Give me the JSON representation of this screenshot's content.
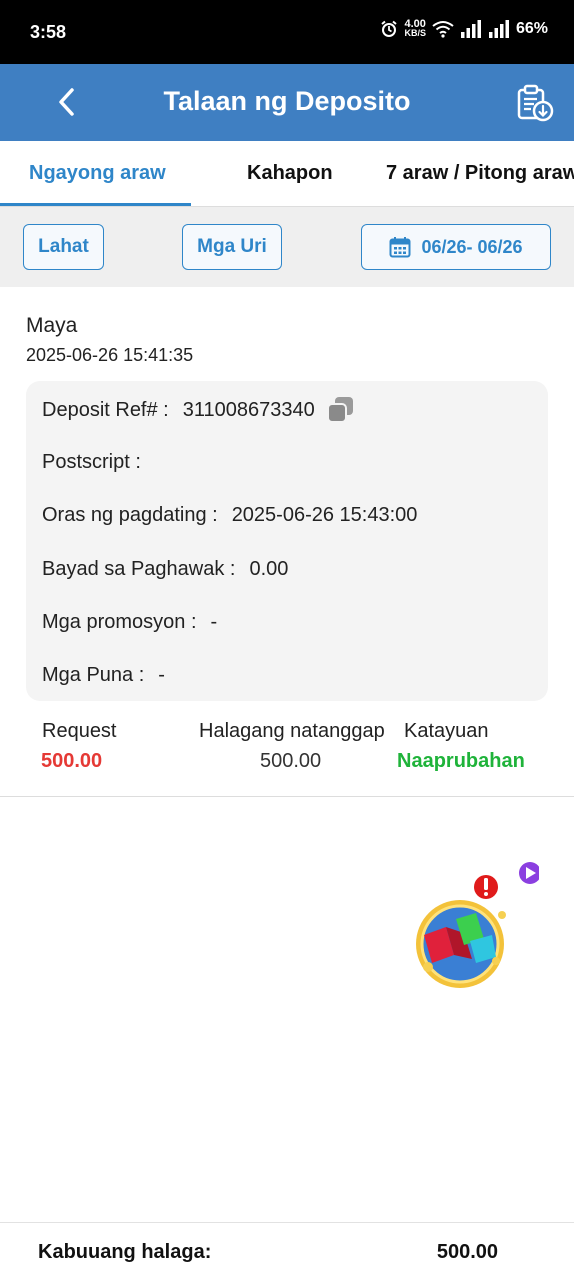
{
  "status_bar": {
    "time": "3:58",
    "net_speed_value": "4.00",
    "net_speed_unit": "KB/S",
    "battery": "66%"
  },
  "header": {
    "title": "Talaan ng Deposito",
    "back_icon": "chevron-left-icon",
    "report_icon": "clipboard-download-icon"
  },
  "tabs": [
    {
      "label": "Ngayong araw",
      "active": true
    },
    {
      "label": "Kahapon",
      "active": false
    },
    {
      "label": "7 araw / Pitong araw",
      "active": false
    }
  ],
  "filters": {
    "all_label": "Lahat",
    "types_label": "Mga Uri",
    "date_range": "06/26- 06/26",
    "calendar_icon": "calendar-icon"
  },
  "record": {
    "method": "Maya",
    "datetime": "2025-06-26 15:41:35",
    "details": [
      {
        "label": "Deposit Ref# :",
        "value": "311008673340",
        "copyable": true
      },
      {
        "label": "Postscript :",
        "value": ""
      },
      {
        "label": "Oras ng pagdating :",
        "value": "2025-06-26 15:43:00"
      },
      {
        "label": "Bayad sa Paghawak :",
        "value": "0.00"
      },
      {
        "label": "Mga promosyon :",
        "value": "-"
      },
      {
        "label": "Mga Puna :",
        "value": "-"
      }
    ],
    "summary": {
      "request_label": "Request",
      "request_value": "500.00",
      "received_label": "Halagang natanggap",
      "received_value": "500.00",
      "status_label": "Katayuan",
      "status_value": "Naaprubahan"
    }
  },
  "footer": {
    "total_label": "Kabuuang halaga:",
    "total_value": "500.00"
  },
  "colors": {
    "header_bg": "#3f7fc2",
    "accent": "#2f86c9",
    "request_red": "#e53935",
    "status_green": "#1fb33a"
  }
}
